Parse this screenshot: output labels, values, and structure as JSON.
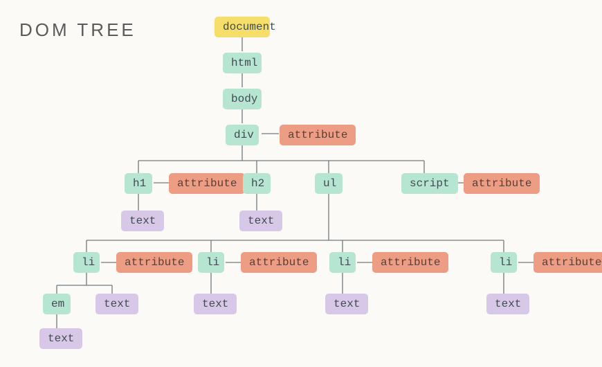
{
  "title": "DOM TREE",
  "labels": {
    "document": "document",
    "html": "html",
    "body": "body",
    "div": "div",
    "attribute": "attribute",
    "h1": "h1",
    "h2": "h2",
    "ul": "ul",
    "script": "script",
    "text": "text",
    "li": "li",
    "em": "em"
  }
}
